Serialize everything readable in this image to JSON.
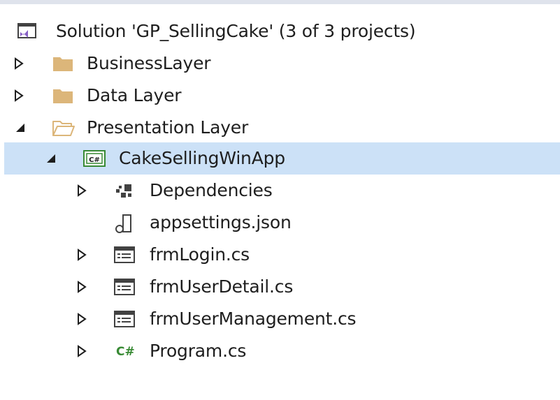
{
  "explorer": {
    "solution": {
      "label": "Solution 'GP_SellingCake' (3 of 3 projects)",
      "icon": "solution-icon"
    },
    "items": [
      {
        "label": "BusinessLayer",
        "icon": "folder-icon",
        "expand": "collapsed"
      },
      {
        "label": "Data Layer",
        "icon": "folder-icon",
        "expand": "collapsed"
      },
      {
        "label": "Presentation Layer",
        "icon": "folder-open-icon",
        "expand": "expanded"
      },
      {
        "label": "CakeSellingWinApp",
        "icon": "csharp-project-icon",
        "expand": "expanded",
        "selected": true
      },
      {
        "label": "Dependencies",
        "icon": "dependencies-icon",
        "expand": "collapsed"
      },
      {
        "label": "appsettings.json",
        "icon": "json-file-icon",
        "expand": "none"
      },
      {
        "label": "frmLogin.cs",
        "icon": "form-icon",
        "expand": "collapsed"
      },
      {
        "label": "frmUserDetail.cs",
        "icon": "form-icon",
        "expand": "collapsed"
      },
      {
        "label": "frmUserManagement.cs",
        "icon": "form-icon",
        "expand": "collapsed"
      },
      {
        "label": "Program.cs",
        "icon": "csharp-file-icon",
        "expand": "collapsed"
      }
    ],
    "colors": {
      "selection": "#cce1f7",
      "folder": "#dcb67a",
      "csharp": "#388a34",
      "visual_studio": "#865fc5",
      "text": "#1e1e1e"
    }
  }
}
